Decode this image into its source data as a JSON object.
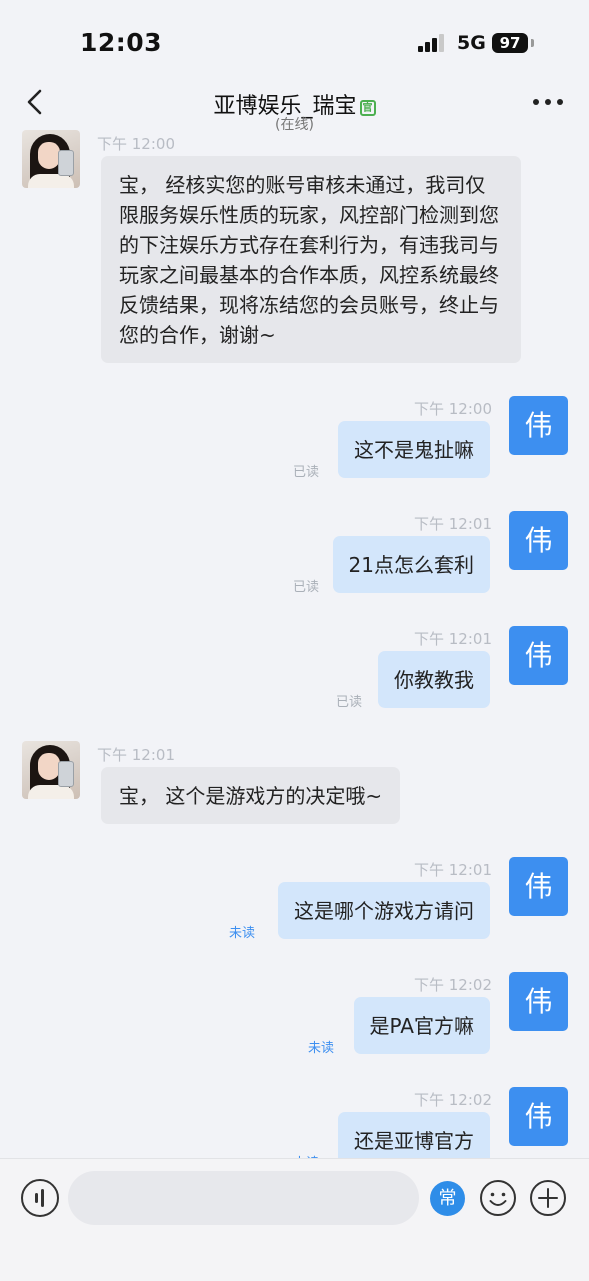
{
  "status_bar": {
    "time": "12:03",
    "network": "5G",
    "battery": "97"
  },
  "header": {
    "title": "亚博娱乐_瑞宝",
    "official_badge": "官",
    "subtitle": "(在线)",
    "back_icon": "chevron-left-icon",
    "more_icon": "more-dots-icon"
  },
  "colors": {
    "background": "#f2f3f7",
    "incoming_bubble": "#e6e7eb",
    "outgoing_bubble": "#d3e6fb",
    "my_avatar": "#3d8ff0",
    "unread_label": "#3d8ff0"
  },
  "messages": [
    {
      "from": "them",
      "time": "下午 12:00",
      "text": "宝， 经核实您的账号审核未通过，我司仅限服务娱乐性质的玩家，风控部门检测到您的下注娱乐方式存在套利行为，有违我司与玩家之间最基本的合作本质，风控系统最终反馈结果，现将冻结您的会员账号，终止与您的合作，谢谢~"
    },
    {
      "from": "me",
      "time": "下午 12:00",
      "text": "这不是鬼扯嘛",
      "avatar": "伟",
      "status": "已读"
    },
    {
      "from": "me",
      "time": "下午 12:01",
      "text": "21点怎么套利",
      "avatar": "伟",
      "status": "已读"
    },
    {
      "from": "me",
      "time": "下午 12:01",
      "text": "你教教我",
      "avatar": "伟",
      "status": "已读"
    },
    {
      "from": "them",
      "time": "下午 12:01",
      "text": "宝， 这个是游戏方的决定哦~"
    },
    {
      "from": "me",
      "time": "下午 12:01",
      "text": "这是哪个游戏方请问",
      "avatar": "伟",
      "status": "未读"
    },
    {
      "from": "me",
      "time": "下午 12:02",
      "text": "是PA官方嘛",
      "avatar": "伟",
      "status": "未读"
    },
    {
      "from": "me",
      "time": "下午 12:02",
      "text": "还是亚博官方",
      "avatar": "伟",
      "status": "未读"
    }
  ],
  "input_bar": {
    "voice_icon": "voice-icon",
    "input_value": "",
    "phrases_button": "常",
    "emoji_icon": "emoji-icon",
    "plus_icon": "plus-icon"
  }
}
